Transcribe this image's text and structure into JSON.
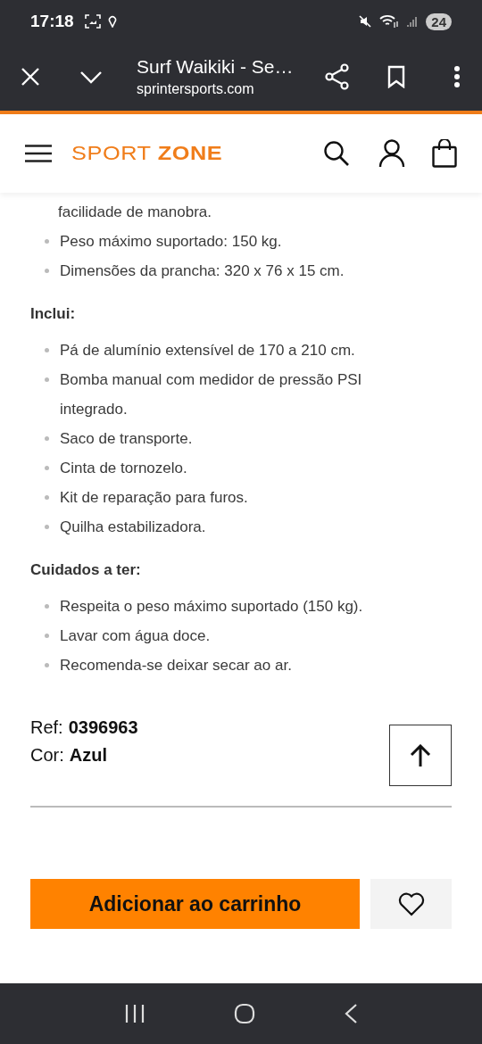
{
  "status_bar": {
    "time": "17:18",
    "battery": "24"
  },
  "browser": {
    "title": "Surf Waikiki - Se…",
    "url": "sprintersports.com"
  },
  "header": {
    "logo": "SPORT **ZONE**"
  },
  "description": {
    "continuation": "facilidade de manobra.",
    "sections": [
      {
        "items": [
          "Peso máximo suportado: 150 kg.",
          "Dimensões da prancha: 320 x 76 x 15 cm."
        ]
      },
      {
        "heading": "Inclui:",
        "items": [
          "Pá de alumínio extensível de 170 a 210 cm.",
          "Bomba manual com medidor de pressão PSI integrado.",
          "Saco de transporte.",
          "Cinta de tornozelo.",
          "Kit de reparação para furos.",
          "Quilha estabilizadora."
        ]
      },
      {
        "heading": "Cuidados a ter:",
        "items": [
          "Respeita o peso máximo suportado (150 kg).",
          "Lavar com água doce.",
          "Recomenda-se deixar secar ao ar."
        ]
      }
    ]
  },
  "details": [
    {
      "label": "Ref:",
      "value": "0396963"
    },
    {
      "label": "Cor:",
      "value": "Azul"
    }
  ],
  "actions": {
    "add_to_cart": "Adicionar ao carrinho"
  }
}
